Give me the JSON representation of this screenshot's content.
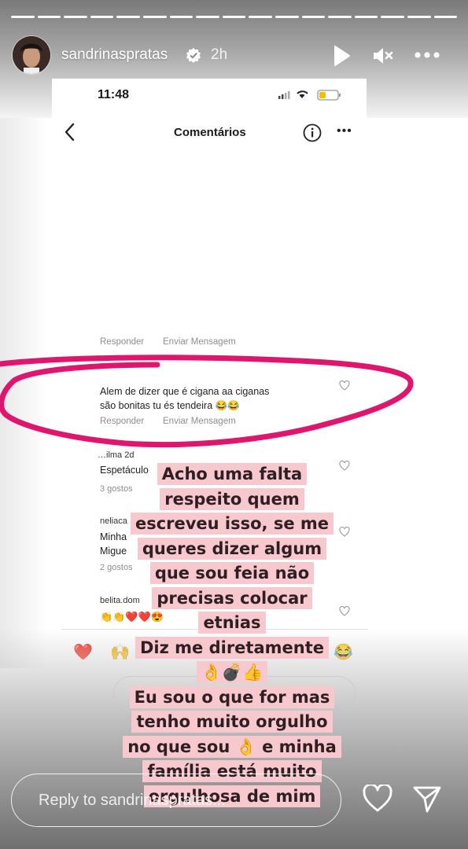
{
  "story": {
    "segments": 17,
    "username": "sandrinaspratas",
    "time_ago": "2h",
    "reply_placeholder": "Reply to sandrinaspratas..."
  },
  "screenshot": {
    "status_time": "11:48",
    "title": "Comentários",
    "actions": {
      "reply": "Responder",
      "message": "Enviar Mensagem"
    },
    "highlighted_comment": {
      "line1": "Alem de dizer  que é  cigana  aa ciganas",
      "line2": "são  bonitas tu és  tendeira 😂😂"
    },
    "comments": [
      {
        "user": "…ilma 2d",
        "text": "Espetáculo",
        "likes": "3 gostos"
      },
      {
        "user": "neliaca",
        "text1": "Minha",
        "text2": "Migue",
        "likes": "2 gostos"
      },
      {
        "user": "belita.dom",
        "text": "👏👏❤️❤️😍"
      }
    ],
    "emoji_bar": [
      "❤️",
      "🙌",
      "😂"
    ]
  },
  "caption_lines": [
    "Acho uma falta",
    "respeito quem",
    "escreveu isso, se me",
    "queres dizer algum",
    "que sou feia não",
    "precisas colocar",
    "etnias",
    "Diz me diretamente",
    "👌💣👍",
    "Eu sou o que for mas",
    "tenho muito orgulho",
    "no que sou 👌 e minha",
    "família está muito",
    "orgulhosa de mim"
  ],
  "colors": {
    "circle": "#e0166e",
    "caption_bg": "#f8c8cf"
  }
}
